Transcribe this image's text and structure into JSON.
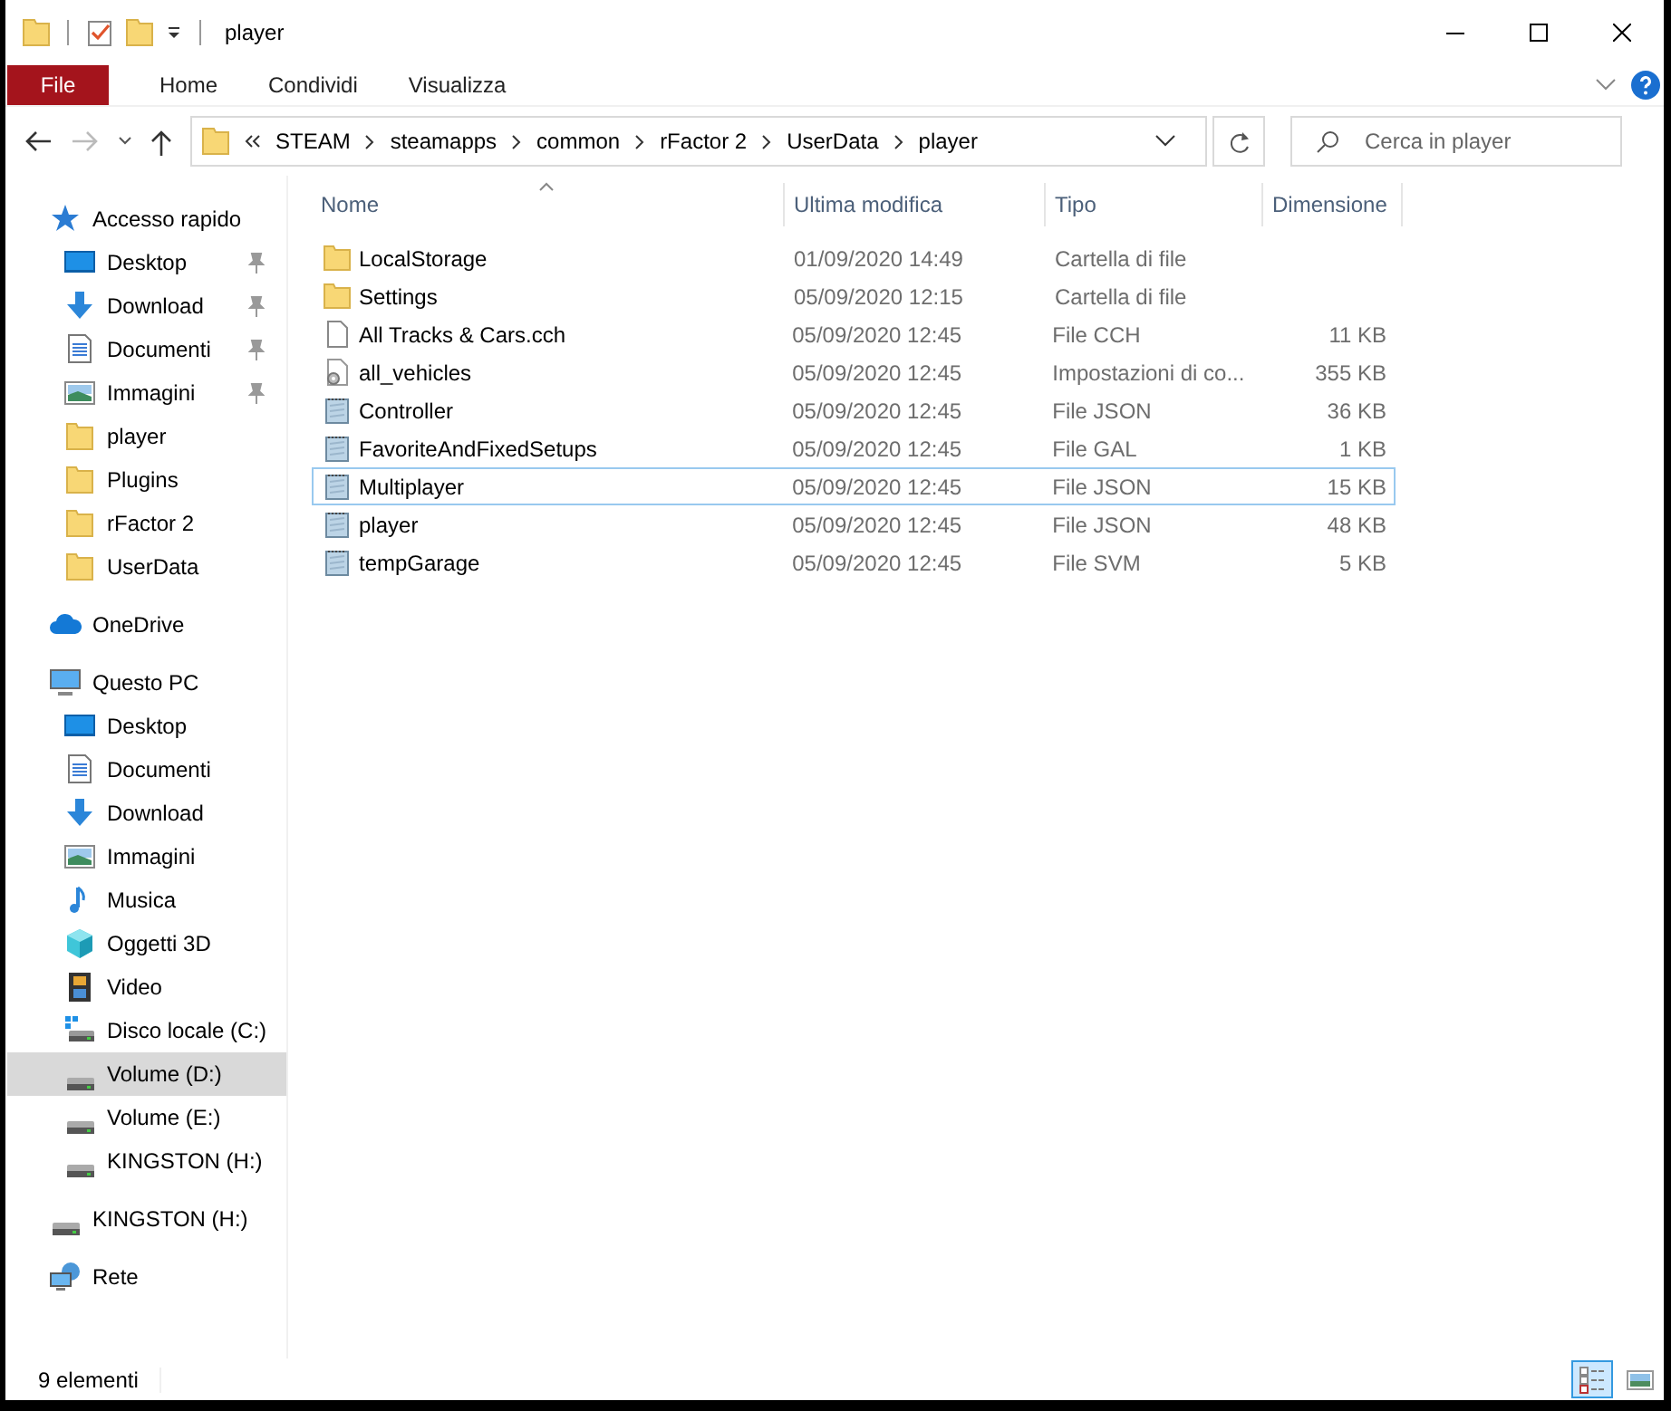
{
  "window": {
    "title": "player"
  },
  "ribbon": {
    "tabs": [
      {
        "label": "File",
        "kind": "file"
      },
      {
        "label": "Home",
        "kind": "tab"
      },
      {
        "label": "Condividi",
        "kind": "tab"
      },
      {
        "label": "Visualizza",
        "kind": "tab"
      }
    ]
  },
  "address_bar": {
    "path": [
      "STEAM",
      "steamapps",
      "common",
      "rFactor 2",
      "UserData",
      "player"
    ]
  },
  "search": {
    "placeholder": "Cerca in player"
  },
  "navigation": [
    {
      "label": "Accesso rapido",
      "kind": "star",
      "selected": false,
      "children": [
        {
          "label": "Desktop",
          "kind": "desktop",
          "pinned": true,
          "selected": false
        },
        {
          "label": "Download",
          "kind": "download",
          "pinned": true,
          "selected": false
        },
        {
          "label": "Documenti",
          "kind": "documents",
          "pinned": true,
          "selected": false
        },
        {
          "label": "Immagini",
          "kind": "pictures",
          "pinned": true,
          "selected": false
        },
        {
          "label": "player",
          "kind": "folder",
          "pinned": false,
          "selected": false
        },
        {
          "label": "Plugins",
          "kind": "folder",
          "pinned": false,
          "selected": false
        },
        {
          "label": "rFactor 2",
          "kind": "folder",
          "pinned": false,
          "selected": false
        },
        {
          "label": "UserData",
          "kind": "folder",
          "pinned": false,
          "selected": false
        }
      ]
    },
    {
      "label": "OneDrive",
      "kind": "cloud",
      "selected": false
    },
    {
      "label": "Questo PC",
      "kind": "pc",
      "selected": false,
      "children": [
        {
          "label": "Desktop",
          "kind": "desktop",
          "selected": false
        },
        {
          "label": "Documenti",
          "kind": "documents",
          "selected": false
        },
        {
          "label": "Download",
          "kind": "download",
          "selected": false
        },
        {
          "label": "Immagini",
          "kind": "pictures",
          "selected": false
        },
        {
          "label": "Musica",
          "kind": "music",
          "selected": false
        },
        {
          "label": "Oggetti 3D",
          "kind": "cube",
          "selected": false
        },
        {
          "label": "Video",
          "kind": "video",
          "selected": false
        },
        {
          "label": "Disco locale (C:)",
          "kind": "drive-windows",
          "selected": false
        },
        {
          "label": "Volume (D:)",
          "kind": "drive",
          "selected": true
        },
        {
          "label": "Volume (E:)",
          "kind": "drive",
          "selected": false
        },
        {
          "label": "KINGSTON (H:)",
          "kind": "drive",
          "selected": false
        }
      ]
    },
    {
      "label": "KINGSTON (H:)",
      "kind": "drive",
      "selected": false
    },
    {
      "label": "Rete",
      "kind": "network",
      "selected": false
    }
  ],
  "columns": [
    {
      "label": "Nome",
      "sorted": true
    },
    {
      "label": "Ultima modifica",
      "sorted": false
    },
    {
      "label": "Tipo",
      "sorted": false
    },
    {
      "label": "Dimensione",
      "sorted": false
    }
  ],
  "files": [
    {
      "name": "LocalStorage",
      "modified": "01/09/2020 14:49",
      "type": "Cartella di file",
      "kind": "folder",
      "focused": false
    },
    {
      "name": "Settings",
      "modified": "05/09/2020 12:15",
      "type": "Cartella di file",
      "kind": "folder",
      "focused": false
    },
    {
      "name": "All Tracks & Cars.cch",
      "modified": "05/09/2020 12:45",
      "type": "File CCH",
      "size": "11 KB",
      "kind": "blank",
      "focused": false
    },
    {
      "name": "all_vehicles",
      "modified": "05/09/2020 12:45",
      "type": "Impostazioni di co...",
      "size": "355 KB",
      "kind": "settings",
      "focused": false
    },
    {
      "name": "Controller",
      "modified": "05/09/2020 12:45",
      "type": "File JSON",
      "size": "36 KB",
      "kind": "text",
      "focused": false
    },
    {
      "name": "FavoriteAndFixedSetups",
      "modified": "05/09/2020 12:45",
      "type": "File GAL",
      "size": "1 KB",
      "kind": "text",
      "focused": false
    },
    {
      "name": "Multiplayer",
      "modified": "05/09/2020 12:45",
      "type": "File JSON",
      "size": "15 KB",
      "kind": "text",
      "focused": true
    },
    {
      "name": "player",
      "modified": "05/09/2020 12:45",
      "type": "File JSON",
      "size": "48 KB",
      "kind": "text",
      "focused": false
    },
    {
      "name": "tempGarage",
      "modified": "05/09/2020 12:45",
      "type": "File SVM",
      "size": "5 KB",
      "kind": "text",
      "focused": false
    }
  ],
  "status_bar": {
    "count": "9 elementi",
    "views": [
      {
        "kind": "details",
        "selected": true
      },
      {
        "kind": "large-icons",
        "selected": false
      }
    ]
  }
}
